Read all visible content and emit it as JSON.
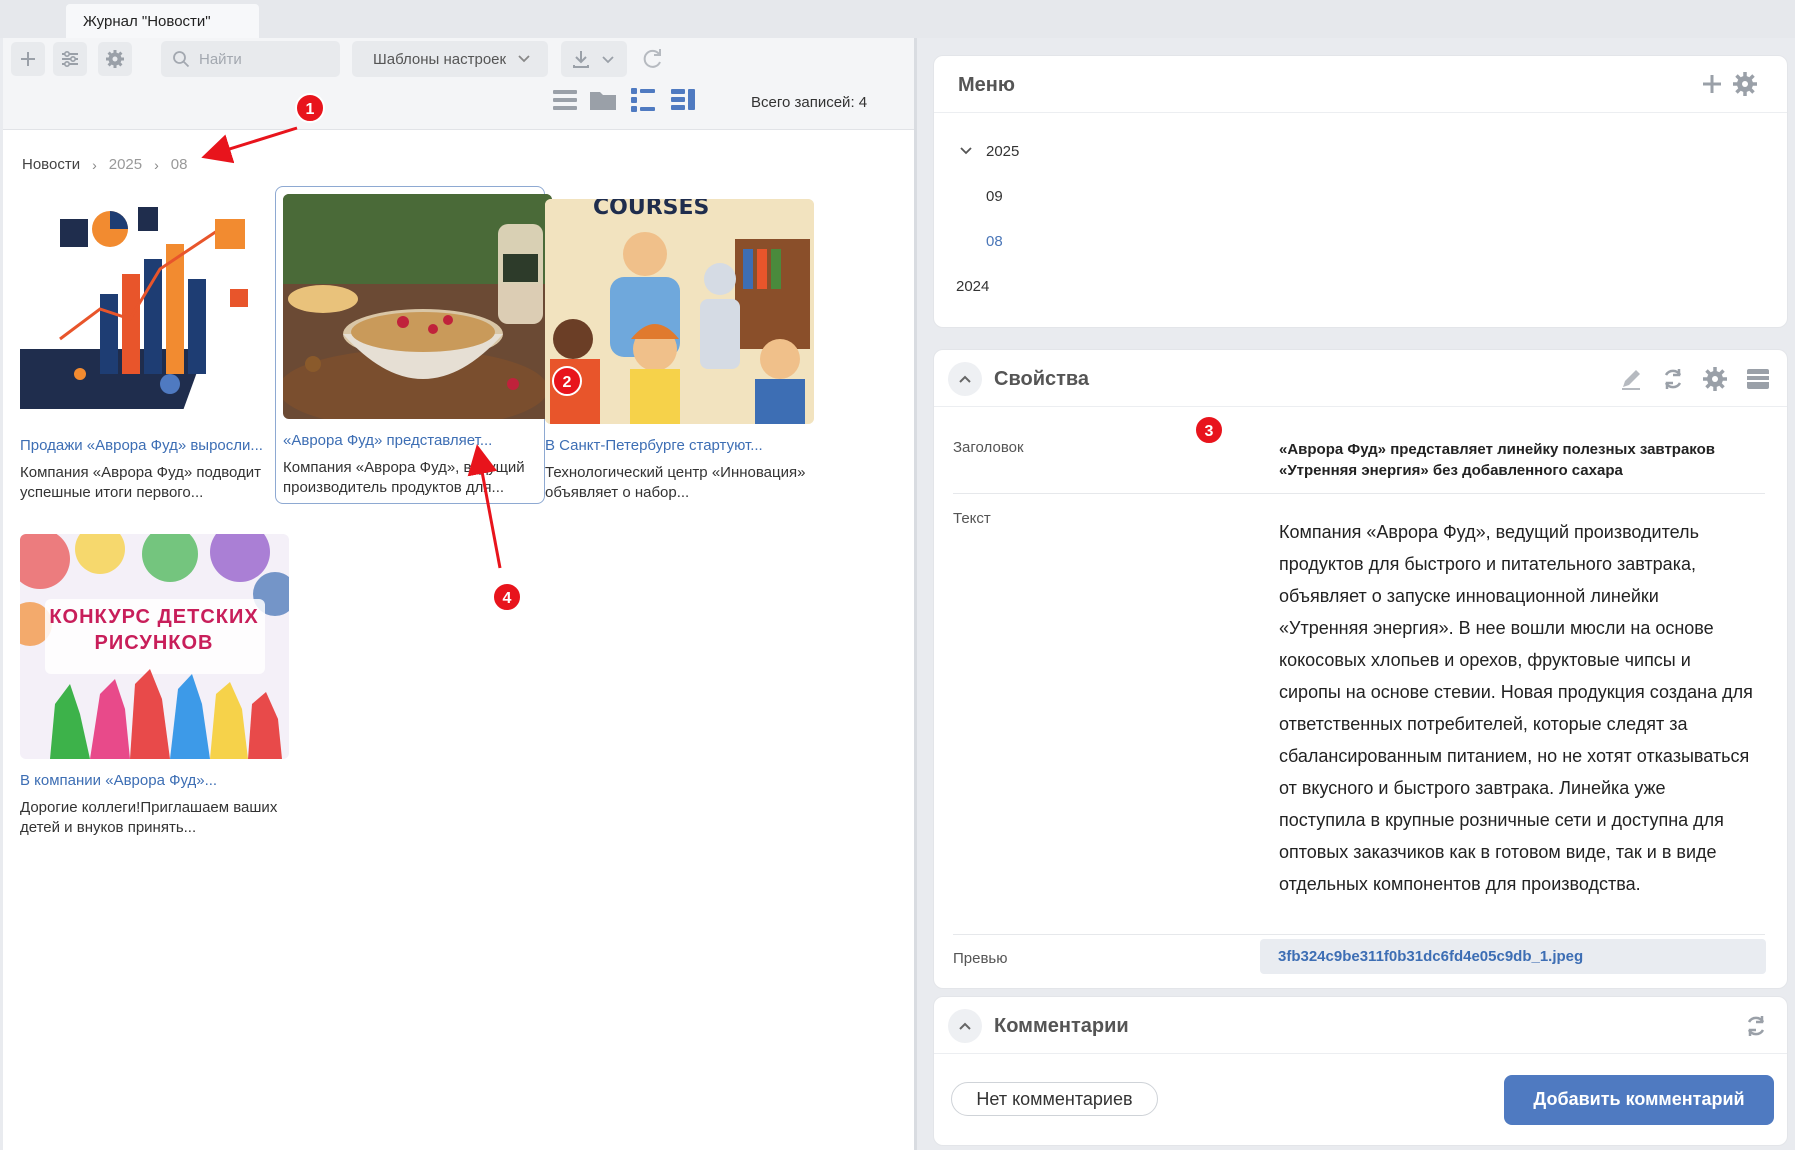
{
  "tab": {
    "title": "Журнал \"Новости\""
  },
  "toolbar": {
    "search_placeholder": "Найти",
    "templates_label": "Шаблоны настроек",
    "total_label": "Всего записей: 4"
  },
  "breadcrumb": [
    "Новости",
    "2025",
    "08"
  ],
  "cards": [
    {
      "title": "Продажи «Аврора Фуд» выросли...",
      "desc": "Компания «Аврора Фуд» подводит успешные итоги первого..."
    },
    {
      "title": "«Аврора Фуд» представляет...",
      "desc": "Компания «Аврора Фуд», ведущий производитель продуктов для..."
    },
    {
      "title": "В Санкт-Петербурге стартуют...",
      "desc": "Технологический центр «Инновация» объявляет о набор...",
      "img_text": "COURSES"
    },
    {
      "title": "В компании «Аврора Фуд»...",
      "desc": "Дорогие коллеги!Приглашаем ваших детей и внуков принять...",
      "img_text_1": "КОНКУРС ДЕТСКИХ",
      "img_text_2": "РИСУНКОВ"
    }
  ],
  "menu": {
    "title": "Меню",
    "items": [
      "2025",
      "09",
      "08",
      "2024"
    ]
  },
  "properties": {
    "title": "Свойства",
    "labels": {
      "heading": "Заголовок",
      "text": "Текст",
      "preview": "Превью"
    },
    "heading_line1": "«Аврора Фуд» представляет линейку полезных завтраков",
    "heading_line2": "«Утренняя энергия» без добавленного сахара",
    "text_lines": [
      "Компания «Аврора Фуд», ведущий производитель",
      "продуктов для быстрого и питательного завтрака,",
      "объявляет о запуске инновационной линейки",
      "«Утренняя энергия». В нее вошли мюсли на основе",
      "кокосовых хлопьев и орехов, фруктовые чипсы и",
      "сиропы на основе стевии. Новая продукция создана для",
      "ответственных потребителей, которые следят за",
      "сбалансированным питанием, но не хотят отказываться",
      "от вкусного и быстрого завтрака. Линейка уже",
      "поступила в крупные розничные сети и доступна для",
      "оптовых заказчиков как в готовом виде, так и в виде",
      "отдельных компонентов для производства."
    ],
    "preview_file": "3fb324c9be311f0b31dc6fd4e05c9db_1.jpeg"
  },
  "comments": {
    "title": "Комментарии",
    "empty_label": "Нет комментариев",
    "add_label": "Добавить комментарий"
  },
  "markers": [
    "1",
    "2",
    "3",
    "4"
  ],
  "colors": {
    "accent": "#4f7ac1",
    "link": "#3d6eb4",
    "marker": "#e8141c"
  }
}
